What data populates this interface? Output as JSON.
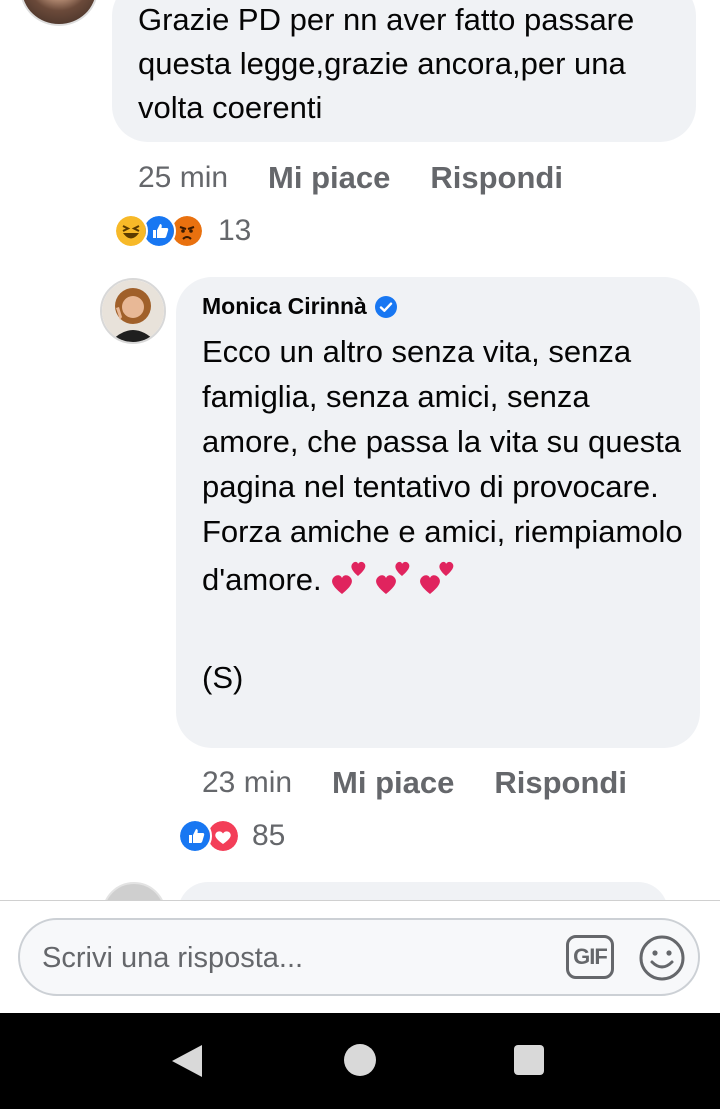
{
  "comment_previous": {
    "text": "Grazie PD per nn aver fatto passare questa legge,grazie ancora,per una volta coerenti",
    "time": "25 min",
    "like_label": "Mi piace",
    "reply_label": "Rispondi",
    "reactions": {
      "icons": [
        "haha-icon",
        "like-icon",
        "angry-icon"
      ],
      "count": "13"
    }
  },
  "comment_reply": {
    "author": "Monica Cirinnà",
    "verified": true,
    "text": "Ecco un altro senza vita, senza famiglia, senza amici, senza amore, che passa la vita su questa pagina nel tentativo di provocare.\nForza amiche e amici, riempiamolo d'amore.",
    "signature": "(S)",
    "time": "23 min",
    "like_label": "Mi piace",
    "reply_label": "Rispondi",
    "reactions": {
      "icons": [
        "like-icon",
        "love-icon"
      ],
      "count": "85"
    }
  },
  "reply_bar": {
    "placeholder": "Scrivi una risposta...",
    "gif_label": "GIF"
  },
  "colors": {
    "bubble_bg": "#f0f2f5",
    "meta_text": "#65676b",
    "like_blue": "#1877f2",
    "love_red": "#f33e58",
    "verified_blue": "#1877f2"
  }
}
